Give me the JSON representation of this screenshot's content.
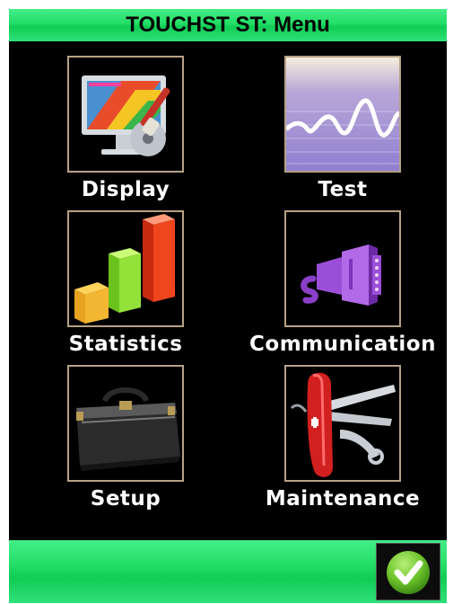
{
  "header": {
    "title": "TOUCHST ST: Menu"
  },
  "menu": {
    "items": [
      {
        "label": "Display",
        "icon": "monitor-paintbrush-icon"
      },
      {
        "label": "Test",
        "icon": "waveform-icon"
      },
      {
        "label": "Statistics",
        "icon": "bar-chart-3d-icon"
      },
      {
        "label": "Communication",
        "icon": "serial-connector-icon"
      },
      {
        "label": "Setup",
        "icon": "toolbag-icon"
      },
      {
        "label": "Maintenance",
        "icon": "swiss-army-knife-icon"
      }
    ]
  },
  "footer": {
    "ok_icon": "checkmark-icon"
  },
  "colors": {
    "accent": "#22dd66",
    "background": "#000000",
    "icon_border": "#b7a185"
  }
}
